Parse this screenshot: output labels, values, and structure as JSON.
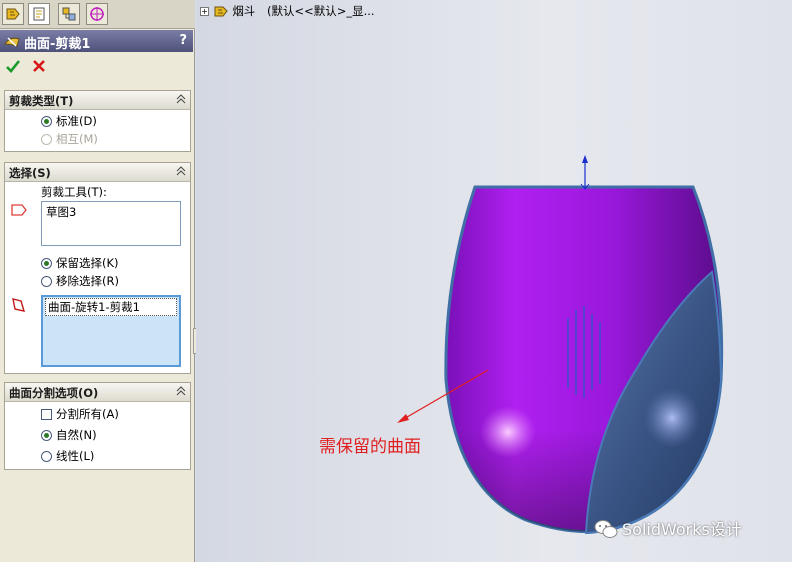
{
  "tree": {
    "part_name": "烟斗",
    "config": "(默认<<默认>_显..."
  },
  "pm": {
    "title": "曲面-剪裁1",
    "help": "?",
    "trim_type": {
      "header": "剪裁类型(T)",
      "standard": "标准(D)",
      "mutual": "相互(M)"
    },
    "selection": {
      "header": "选择(S)",
      "trim_tool_label": "剪裁工具(T):",
      "trim_tool_value": "草图3",
      "keep": "保留选择(K)",
      "remove": "移除选择(R)",
      "pieces_value": "曲面-旋转1-剪裁1"
    },
    "split": {
      "header": "曲面分割选项(O)",
      "split_all": "分割所有(A)",
      "natural": "自然(N)",
      "linear": "线性(L)"
    }
  },
  "annotation": "需保留的曲面",
  "watermark": "SolidWorks设计",
  "colors": {
    "accent_red": "#e02020",
    "surface": "#9a1ee0",
    "trim_blue": "#4a6690"
  },
  "icons": [
    "feature-manager-icon",
    "property-manager-icon",
    "configuration-manager-icon",
    "dimxpert-icon",
    "ok-icon",
    "cancel-icon",
    "wechat-icon"
  ]
}
